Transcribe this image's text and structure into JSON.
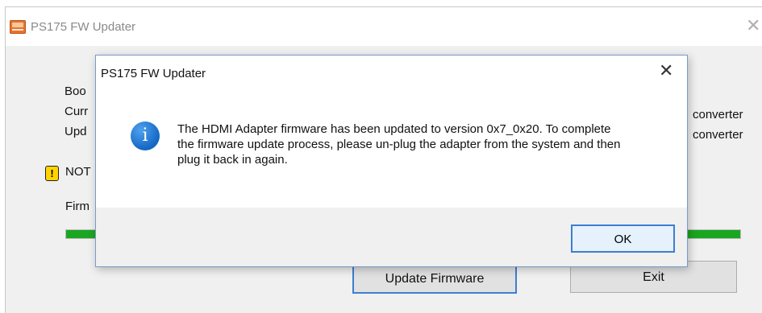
{
  "main_window": {
    "title": "PS175 FW Updater",
    "close_glyph": "✕",
    "info_lines": [
      "Boo",
      "Curr",
      "Upd"
    ],
    "right_texts": [
      "converter",
      "converter"
    ],
    "warning_text": "NOT",
    "firmware_label": "Firm",
    "progress_fraction": 1.0,
    "progress_color": "#1aa620",
    "buttons": {
      "update": "Update Firmware",
      "exit": "Exit"
    }
  },
  "dialog": {
    "title": "PS175 FW Updater",
    "close_glyph": "✕",
    "icon": "info-icon",
    "icon_glyph": "i",
    "message": "The HDMI Adapter firmware has been updated to version 0x7_0x20.  To complete the firmware update process, please un-plug the adapter from the system and then plug it back in again.",
    "ok_label": "OK"
  },
  "colors": {
    "accent": "#3c7fd0",
    "warning": "#ffd400",
    "info": "#1467c4"
  }
}
